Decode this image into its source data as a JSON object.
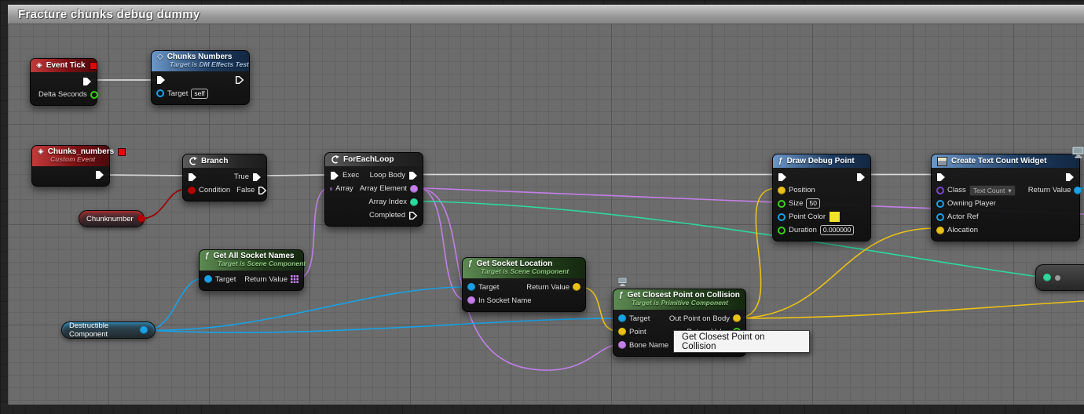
{
  "comment_title": "Fracture chunks debug dummy",
  "tooltip": "Get Closest Point on Collision",
  "colors": {
    "exec": "#ffffff",
    "bool": "#b90000",
    "float": "#3ad117",
    "int": "#2ed79b",
    "object": "#18a1e6",
    "name": "#c27fe8",
    "vector": "#eac117",
    "class": "#7a46c9",
    "wire_exec": "#d8d8d8",
    "wire_bool": "#a00000"
  },
  "nodes": {
    "event_tick": {
      "title": "Event Tick",
      "out": "Delta Seconds"
    },
    "chunks_numbers_call": {
      "title": "Chunks Numbers",
      "subtitle": "Target is DM Effects Test",
      "target": "Target",
      "target_value": "self"
    },
    "chunks_numbers_event": {
      "title": "Chunks_numbers",
      "subtitle": "Custom Event"
    },
    "branch": {
      "title": "Branch",
      "condition": "Condition",
      "true_label": "True",
      "false_label": "False"
    },
    "foreach": {
      "title": "ForEachLoop",
      "exec": "Exec",
      "array": "Array",
      "loop_body": "Loop Body",
      "array_element": "Array Element",
      "array_index": "Array Index",
      "completed": "Completed"
    },
    "get_all_socket_names": {
      "title": "Get All Socket Names",
      "subtitle": "Target is Scene Component",
      "target": "Target",
      "return": "Return Value"
    },
    "get_socket_location": {
      "title": "Get Socket Location",
      "subtitle": "Target is Scene Component",
      "target": "Target",
      "in_socket_name": "In Socket Name",
      "return": "Return Value"
    },
    "get_closest_point": {
      "title": "Get Closest Point on Collision",
      "subtitle": "Target is Primitive Component",
      "target": "Target",
      "point": "Point",
      "bone_name": "Bone Name",
      "out_point": "Out Point on Body",
      "return": "Return Value"
    },
    "draw_debug_point": {
      "title": "Draw Debug Point",
      "position": "Position",
      "size": "Size",
      "size_value": "50",
      "point_color": "Point Color",
      "duration": "Duration",
      "duration_value": "0.000000"
    },
    "create_widget": {
      "title": "Create Text Count Widget",
      "class_label": "Class",
      "class_value": "Text Count",
      "owning_player": "Owning Player",
      "actor_ref": "Actor Ref",
      "alocation": "Alocation",
      "return": "Return Value"
    },
    "vars": {
      "chunknumber": "Chunknumber",
      "destructible": "Destructible Component"
    }
  }
}
